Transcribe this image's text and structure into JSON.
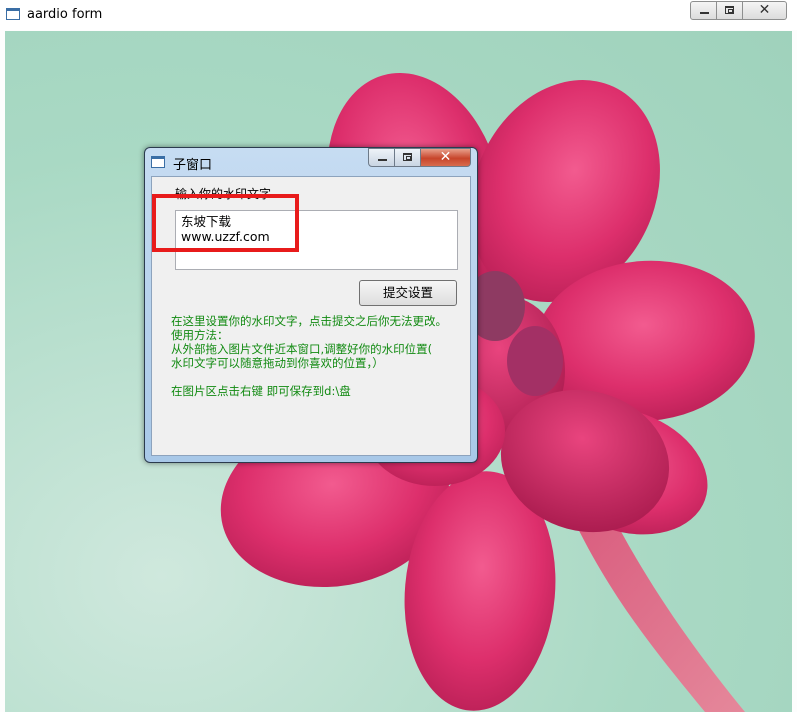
{
  "window": {
    "title": "aardio form",
    "controls": {
      "minimize": "—",
      "maximize": "□",
      "close": "✕"
    }
  },
  "child_window": {
    "title": "子窗口",
    "watermark_label": "输入你的水印文字",
    "watermark_value": "东坡下载\nwww.uzzf.com",
    "submit_label": "提交设置",
    "help_lines": [
      "在这里设置你的水印文字，点击提交之后你无法更改。",
      "使用方法：",
      "从外部拖入图片文件近本窗口,调整好你的水印位置(",
      "水印文字可以随意拖动到你喜欢的位置，）",
      "",
      "在图片区点击右键 即可保存到d:\\盘"
    ]
  },
  "colors": {
    "help_text": "#118a11",
    "highlight": "#e81b1b",
    "petal": "#e0336f",
    "background": "#a9d9c4"
  },
  "icons": [
    "window-icon",
    "minimize-icon",
    "maximize-icon",
    "close-icon"
  ]
}
